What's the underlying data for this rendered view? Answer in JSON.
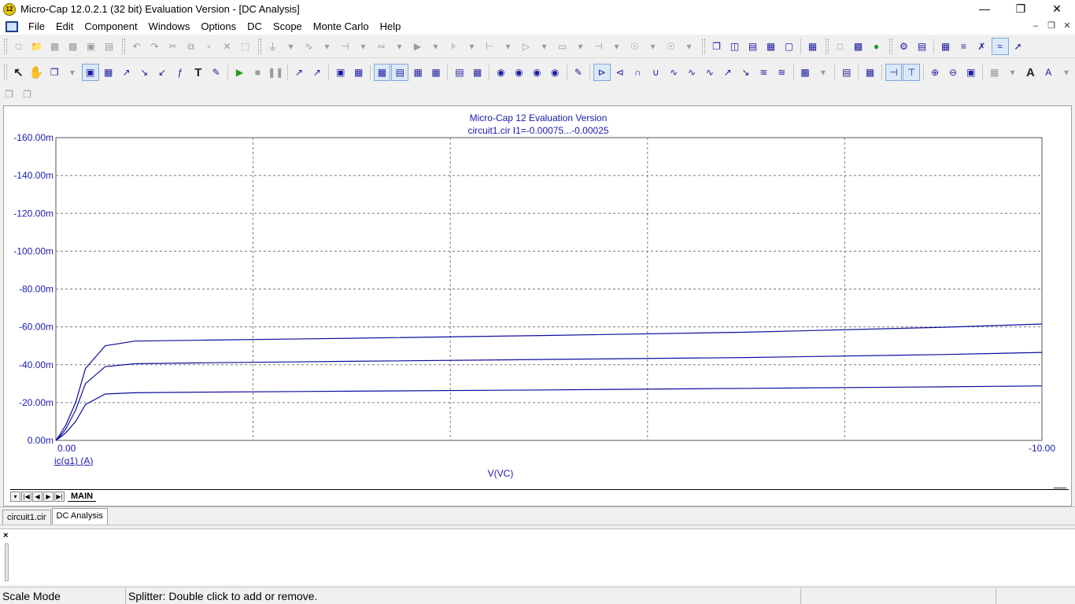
{
  "window": {
    "title": "Micro-Cap 12.0.2.1 (32 bit) Evaluation Version - [DC Analysis]",
    "icon_text": "12",
    "controls": [
      "minimize-icon",
      "restore-icon",
      "close-icon"
    ]
  },
  "menu": {
    "items": [
      "File",
      "Edit",
      "Component",
      "Windows",
      "Options",
      "DC",
      "Scope",
      "Monte Carlo",
      "Help"
    ]
  },
  "chart": {
    "title": "Micro-Cap 12 Evaluation Version",
    "subtitle": "circuit1.cir I1=-0.00075...-0.00025",
    "y_expression": "ic(q1) (A)",
    "x_expression": "V(VC)",
    "colors": {
      "trace": "#0d0d9e",
      "axis_text": "#1a1ab0",
      "grid": "#7a7a7a"
    }
  },
  "chart_data": {
    "type": "line",
    "title": "Micro-Cap 12 Evaluation Version",
    "subtitle": "circuit1.cir I1=-0.00075...-0.00025",
    "xlabel": "V(VC)",
    "ylabel": "ic(q1) (A)",
    "xlim": [
      0,
      -10
    ],
    "ylim": [
      0,
      -160
    ],
    "y_unit": "m",
    "x_ticks": [
      "0.00",
      "-10.00"
    ],
    "y_ticks": [
      "0.00m",
      "-20.00m",
      "-40.00m",
      "-60.00m",
      "-80.00m",
      "-100.00m",
      "-120.00m",
      "-140.00m",
      "-160.00m"
    ],
    "grid": true,
    "series": [
      {
        "x": [
          0,
          -0.04,
          -0.1,
          -0.2,
          -0.3,
          -0.5,
          -0.8,
          -1.5,
          -3,
          -5,
          -7,
          -9,
          -10
        ],
        "y": [
          0,
          -3,
          -8,
          -20,
          -38,
          -50,
          -52.5,
          -53,
          -54,
          -55.5,
          -57.2,
          -59.8,
          -61.5
        ]
      },
      {
        "x": [
          0,
          -0.04,
          -0.1,
          -0.2,
          -0.3,
          -0.5,
          -0.8,
          -1.5,
          -3,
          -5,
          -7,
          -9,
          -10
        ],
        "y": [
          0,
          -2,
          -6,
          -16,
          -30,
          -39,
          -40.5,
          -41,
          -41.8,
          -42.8,
          -43.8,
          -45.4,
          -46.5
        ]
      },
      {
        "x": [
          0,
          -0.04,
          -0.1,
          -0.2,
          -0.3,
          -0.5,
          -0.8,
          -1.5,
          -3,
          -5,
          -7,
          -9,
          -10
        ],
        "y": [
          0,
          -1.5,
          -4,
          -10,
          -19,
          -24.5,
          -25.2,
          -25.5,
          -26,
          -26.7,
          -27.5,
          -28.3,
          -28.8
        ]
      }
    ]
  },
  "sheet_tabs": {
    "nav_buttons": [
      "▾",
      "|◀",
      "◀",
      "▶",
      "▶|"
    ],
    "active": "MAIN"
  },
  "doc_tabs": [
    "circuit1.cir",
    "DC Analysis"
  ],
  "output_pane": {
    "close": "×"
  },
  "status": {
    "mode": "Scale Mode",
    "message": "Splitter: Double click to add or remove."
  }
}
